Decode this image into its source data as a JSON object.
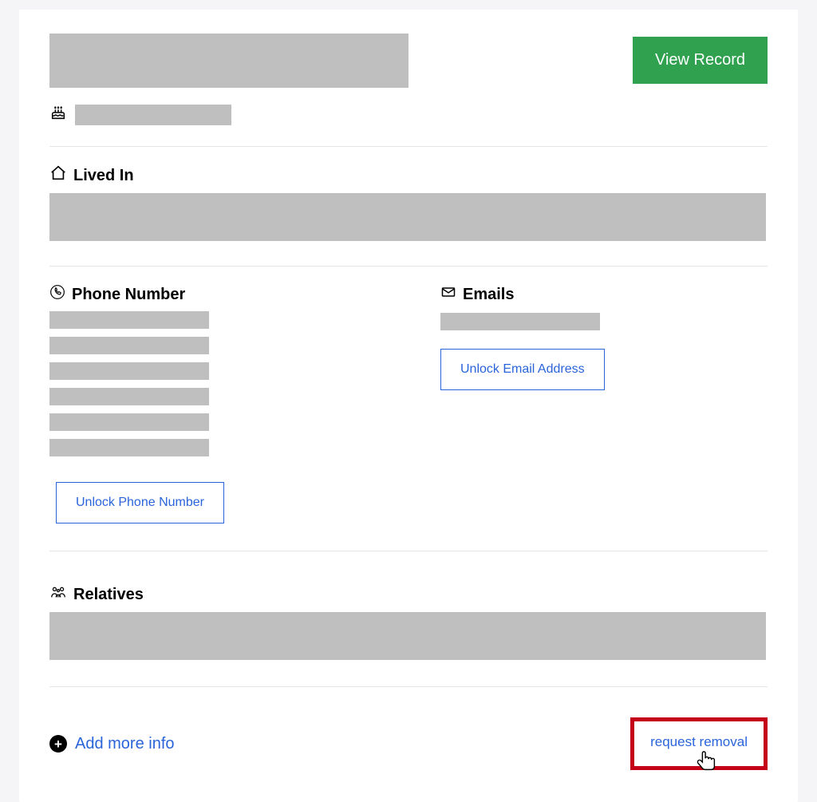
{
  "header": {
    "view_record_label": "View Record"
  },
  "sections": {
    "lived_in": {
      "title": "Lived In"
    },
    "phone": {
      "title": "Phone Number",
      "unlock_label": "Unlock Phone Number"
    },
    "emails": {
      "title": "Emails",
      "unlock_label": "Unlock Email Address"
    },
    "relatives": {
      "title": "Relatives"
    }
  },
  "footer": {
    "add_more_label": "Add more info",
    "request_removal_label": "request removal"
  }
}
